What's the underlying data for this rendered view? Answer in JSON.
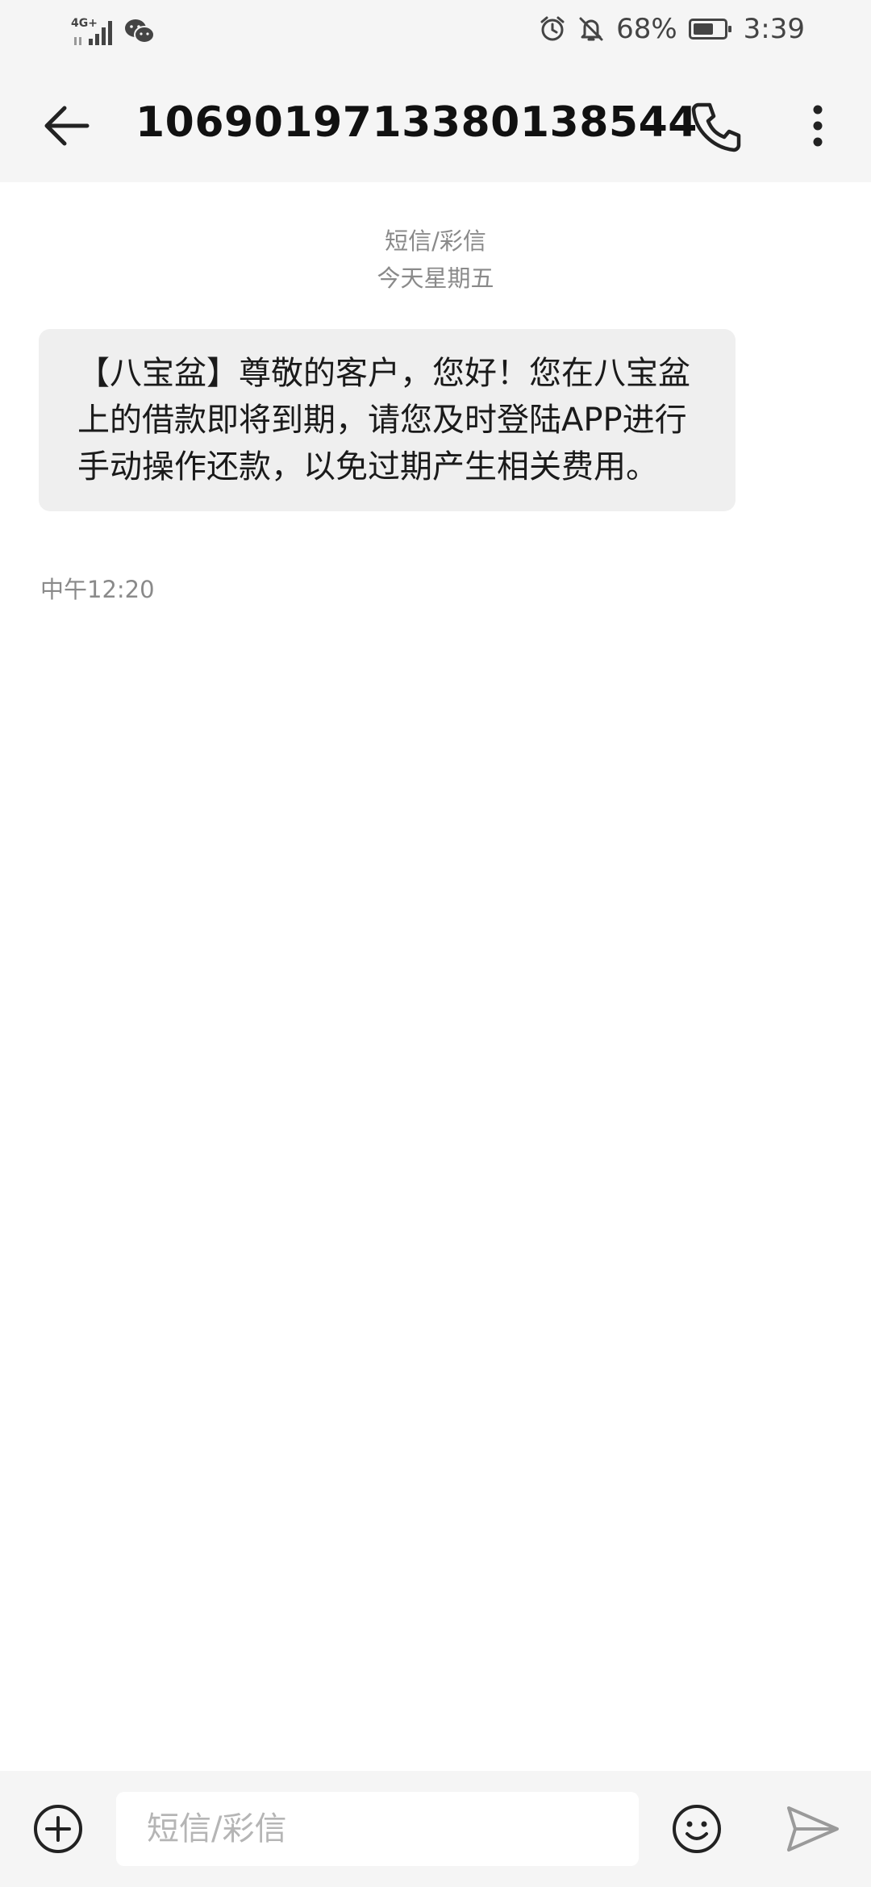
{
  "status_bar": {
    "network": "4G+",
    "battery_text": "68%",
    "battery_level": 0.68,
    "time": "3:39",
    "icons": [
      "signal-icon",
      "wechat-icon",
      "alarm-icon",
      "mute-icon",
      "battery-icon"
    ]
  },
  "header": {
    "title": "1069019713380138544",
    "icons": [
      "back-arrow-icon",
      "phone-icon",
      "more-vertical-icon"
    ]
  },
  "conversation": {
    "message_type": "短信/彩信",
    "date_label": "今天星期五",
    "messages": [
      {
        "text": "【八宝盆】尊敬的客户，您好！您在八宝盆上的借款即将到期，请您及时登陆APP进行手动操作还款，以免过期产生相关费用。",
        "time": "中午12:20"
      }
    ]
  },
  "composer": {
    "placeholder": "短信/彩信",
    "icons": [
      "add-circle-icon",
      "emoji-icon",
      "send-icon"
    ]
  },
  "colors": {
    "bar_background": "#f5f5f5",
    "bubble_background": "#efefef",
    "meta_text": "#8a8a8a"
  }
}
